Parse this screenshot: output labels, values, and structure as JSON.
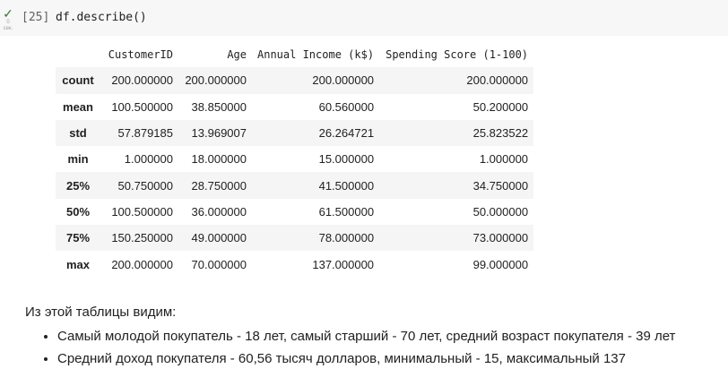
{
  "code_cell": {
    "status_icon": "check-icon",
    "status_color": "#2e7d32",
    "exec_time": "0",
    "exec_unit": "сек.",
    "prompt": "[25]",
    "code": "df.describe()"
  },
  "table": {
    "columns": [
      "",
      "CustomerID",
      "Age",
      "Annual Income (k$)",
      "Spending Score (1-100)"
    ],
    "rows": [
      {
        "stat": "count",
        "values": [
          "200.000000",
          "200.000000",
          "200.000000",
          "200.000000"
        ]
      },
      {
        "stat": "mean",
        "values": [
          "100.500000",
          "38.850000",
          "60.560000",
          "50.200000"
        ]
      },
      {
        "stat": "std",
        "values": [
          "57.879185",
          "13.969007",
          "26.264721",
          "25.823522"
        ]
      },
      {
        "stat": "min",
        "values": [
          "1.000000",
          "18.000000",
          "15.000000",
          "1.000000"
        ]
      },
      {
        "stat": "25%",
        "values": [
          "50.750000",
          "28.750000",
          "41.500000",
          "34.750000"
        ]
      },
      {
        "stat": "50%",
        "values": [
          "100.500000",
          "36.000000",
          "61.500000",
          "50.000000"
        ]
      },
      {
        "stat": "75%",
        "values": [
          "150.250000",
          "49.000000",
          "78.000000",
          "73.000000"
        ]
      },
      {
        "stat": "max",
        "values": [
          "200.000000",
          "70.000000",
          "137.000000",
          "99.000000"
        ]
      }
    ]
  },
  "text_cell": {
    "intro": "Из этой таблицы видим:",
    "bullets": [
      "Самый молодой покупатель - 18 лет, самый старший - 70 лет, средний возраст покупателя - 39 лет",
      "Средний доход покупателя - 60,56 тысяч долларов, минимальный - 15, максимальный 137"
    ]
  }
}
